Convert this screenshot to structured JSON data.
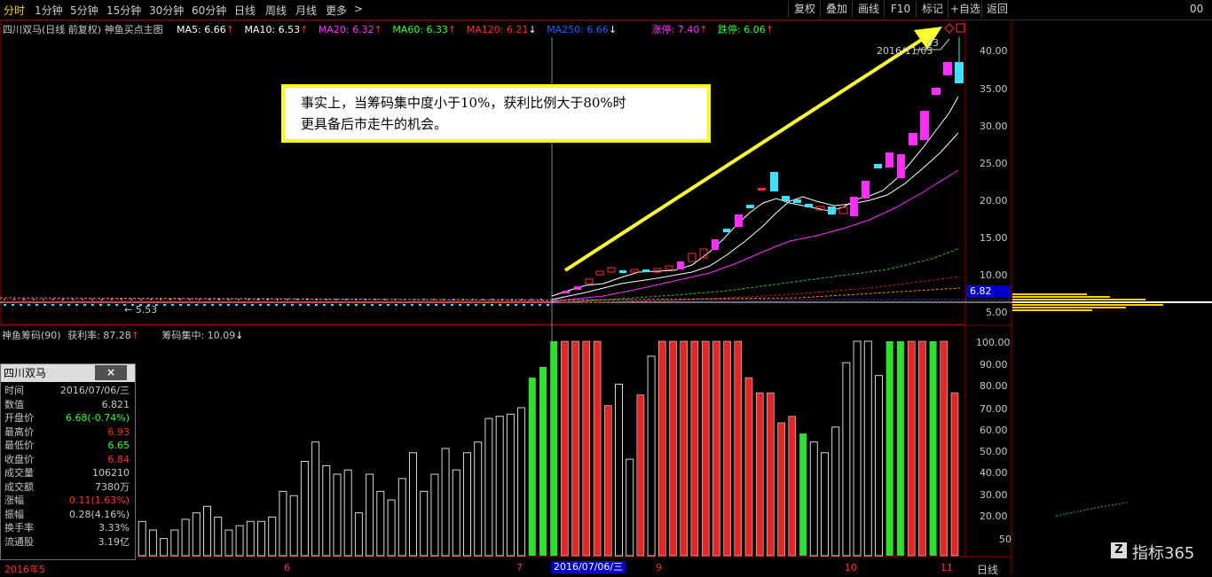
{
  "top_tabs": [
    "分时",
    "1分钟",
    "5分钟",
    "15分钟",
    "30分钟",
    "60分钟",
    "日线",
    "周线",
    "月线",
    "更多"
  ],
  "more_arrow": ">",
  "right_buttons": [
    "复权",
    "叠加",
    "画线",
    "F10",
    "标记",
    "+自选",
    "返回"
  ],
  "right_edge_label": "00",
  "main_chart": {
    "title": "四川双马(日线 前复权) 神鱼买点主图",
    "indicators": [
      {
        "text": "MA5: 6.66",
        "arrow": "↑",
        "color": "#ffffff"
      },
      {
        "text": "MA10: 6.53",
        "arrow": "↑",
        "color": "#ffffff"
      },
      {
        "text": "MA20: 6.32",
        "arrow": "↑",
        "color": "#ff30ff"
      },
      {
        "text": "MA60: 6.33",
        "arrow": "↑",
        "color": "#30ff30"
      },
      {
        "text": "MA120: 6.21",
        "arrow": "↓",
        "color": "#ff3030"
      },
      {
        "text": "MA250: 6.66",
        "arrow": "↓",
        "color": "#2060ff"
      },
      {
        "text": "涨停: 7.40",
        "arrow": "↑",
        "color": "#ff30ff"
      },
      {
        "text": "跌停: 6.06",
        "arrow": "↑",
        "color": "#30ff30"
      }
    ],
    "y_ticks": [
      "40.00",
      "35.00",
      "30.00",
      "25.00",
      "20.00",
      "15.00",
      "10.00",
      "5.00"
    ],
    "price_tag": "6.82",
    "low_label": "5.53",
    "peak_label_date": "2016/11/03",
    "peak_label_value": "83"
  },
  "callout": {
    "line1": "事实上，当筹码集中度小于10%，获利比例大于80%时",
    "line2": "更具备后市走牛的机会。",
    "border_color": "#ffff00"
  },
  "sub_chart": {
    "name": "神鱼筹码(90)",
    "profit_label": "获利率: 87.28",
    "profit_arrow": "↑",
    "conc_label": "筹码集中: 10.09",
    "conc_arrow": "↓",
    "y_ticks": [
      "100.00",
      "90.00",
      "80.00",
      "70.00",
      "60.00",
      "50.00",
      "40.00",
      "30.00",
      "20.00",
      "50"
    ]
  },
  "info_panel": {
    "title": "四川双马",
    "close": "×",
    "rows": [
      {
        "k": "时间",
        "v": "2016/07/06/三",
        "c": "#c8c8c8"
      },
      {
        "k": "数值",
        "v": "6.821",
        "c": "#c8c8c8"
      },
      {
        "k": "开盘价",
        "v": "6.68(-0.74%)",
        "c": "#30ff30"
      },
      {
        "k": "最高价",
        "v": "6.93",
        "c": "#ff3030"
      },
      {
        "k": "最低价",
        "v": "6.65",
        "c": "#30ff30"
      },
      {
        "k": "收盘价",
        "v": "6.84",
        "c": "#ff3030"
      },
      {
        "k": "成交量",
        "v": "106210",
        "c": "#c8c8c8"
      },
      {
        "k": "成交额",
        "v": "7380万",
        "c": "#c8c8c8"
      },
      {
        "k": "涨幅",
        "v": "0.11(1.63%)",
        "c": "#ff3030"
      },
      {
        "k": "振幅",
        "v": "0.28(4.16%)",
        "c": "#c8c8c8"
      },
      {
        "k": "换手率",
        "v": "3.33%",
        "c": "#c8c8c8"
      },
      {
        "k": "流通股",
        "v": "3.19亿",
        "c": "#c8c8c8"
      }
    ]
  },
  "x_axis": {
    "labels": [
      "2016年5",
      "6",
      "7",
      "9",
      "10",
      "11"
    ],
    "cursor_date": "2016/07/06/三",
    "period": "日线"
  },
  "watermark": "指标365",
  "colors": {
    "up": "#ff30ff",
    "down": "#40e0ff",
    "bar_red": "#e02828",
    "bar_green": "#30e030",
    "bar_white": "#d8d8d8",
    "grid": "#8b0000"
  },
  "chart_data": {
    "type": "bar",
    "series": [
      {
        "name": "获利率",
        "values": [
          12,
          16,
          12,
          8,
          12,
          17,
          20,
          23,
          18,
          12,
          14,
          16,
          16,
          18,
          30,
          28,
          44,
          53,
          42,
          38,
          40,
          20,
          38,
          30,
          26,
          36,
          48,
          30,
          38,
          50,
          40,
          48,
          53,
          64,
          65,
          66,
          69,
          83,
          88,
          100,
          100,
          100,
          100,
          100,
          70,
          80,
          45,
          75,
          93,
          100,
          100,
          100,
          100,
          100,
          100,
          100,
          100,
          83,
          76,
          76,
          62,
          65,
          57,
          53,
          48,
          60,
          90,
          100,
          100,
          84,
          100,
          100,
          100,
          100,
          100,
          100,
          76
        ]
      }
    ],
    "bar_colors": "r=red g=green w=white/hollow",
    "bar_kinds": "wwwwwwwwwwwwwwwwwwwwwwwwwwwwwwwwwwwwwgggrrrrrwwrwrrrrrrrrrrrrrgwwwwwwwggrrgrrrrrrw",
    "ylim": [
      0,
      105
    ]
  }
}
